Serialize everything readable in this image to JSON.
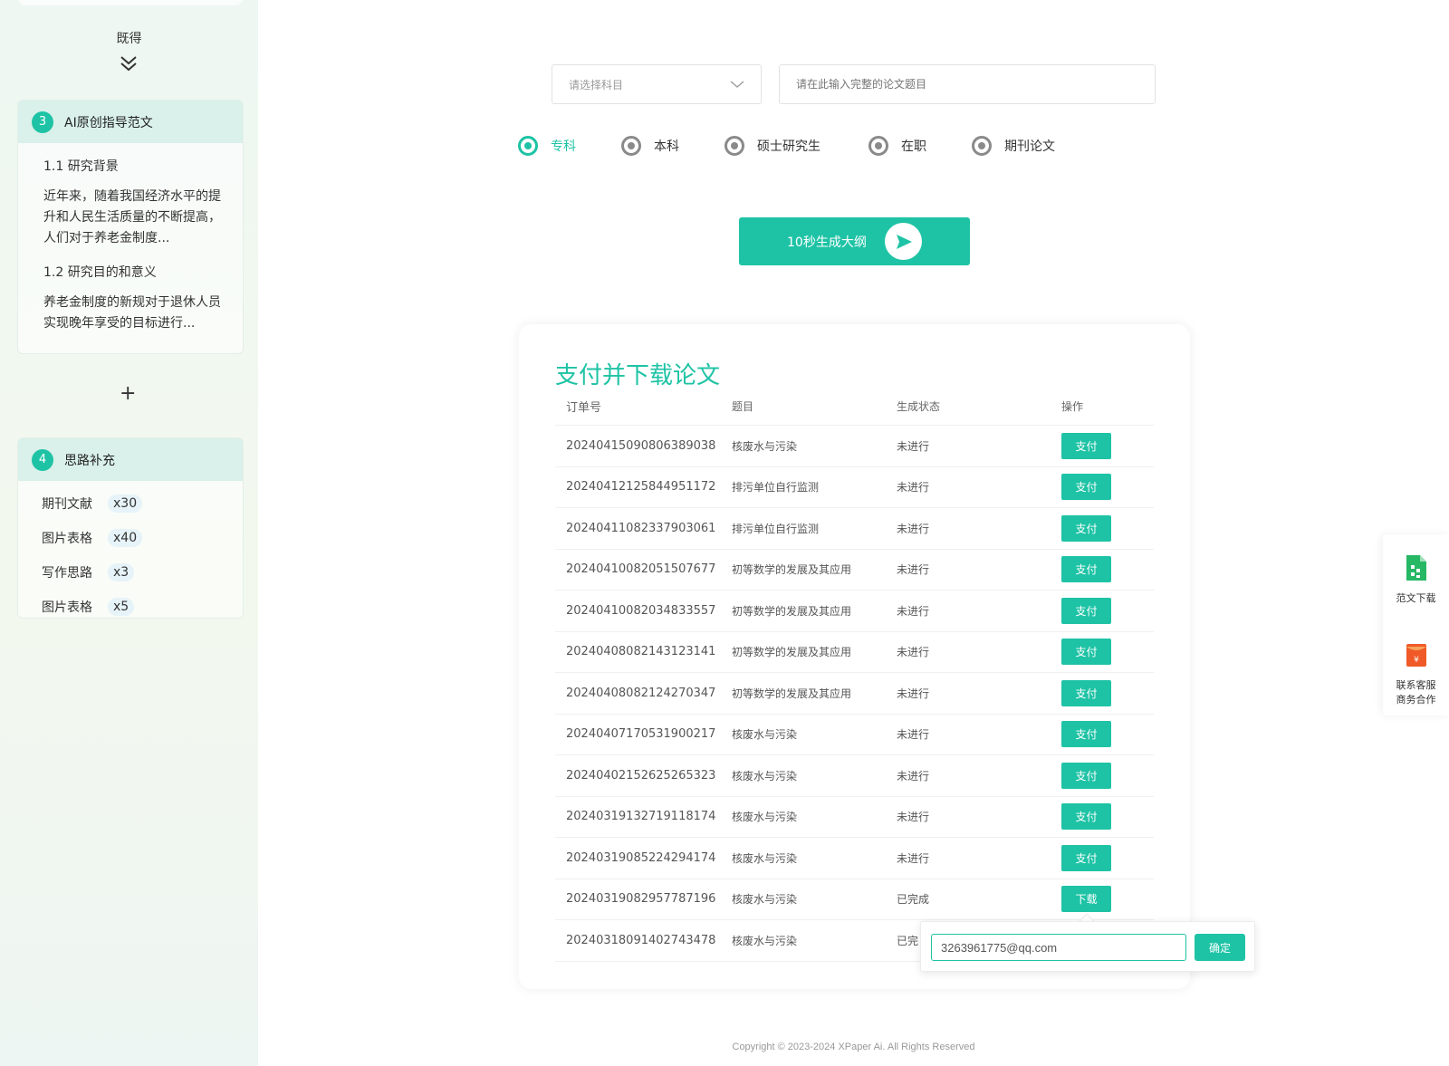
{
  "sidebar": {
    "jide_label": "既得",
    "card3": {
      "number": "3",
      "title": "AI原创指导范文",
      "sections": [
        {
          "title": "1.1 研究背景",
          "text": "近年来，随着我国经济水平的提升和人民生活质量的不断提高，人们对于养老金制度..."
        },
        {
          "title": "1.2 研究目的和意义",
          "text": "养老金制度的新规对于退休人员实现晚年享受的目标进行..."
        }
      ]
    },
    "plus_label": "+",
    "card4": {
      "number": "4",
      "title": "思路补充",
      "tags": [
        {
          "label": "期刊文献",
          "count": "x30"
        },
        {
          "label": "图片表格",
          "count": "x40"
        },
        {
          "label": "写作思路",
          "count": "x3"
        },
        {
          "label": "图片表格",
          "count": "x5"
        }
      ]
    }
  },
  "form": {
    "subject_placeholder": "请选择科目",
    "title_placeholder": "请在此输入完整的论文题目",
    "levels": [
      "专科",
      "本科",
      "硕士研究生",
      "在职",
      "期刊论文"
    ],
    "selected_level": "专科",
    "generate_label": "10秒生成大纲"
  },
  "pay": {
    "title": "支付并下载论文",
    "headers": [
      "订单号",
      "题目",
      "生成状态",
      "操作"
    ],
    "rows": [
      {
        "order": "20240415090806389038",
        "topic": "核废水与污染",
        "status": "未进行",
        "action": "支付"
      },
      {
        "order": "20240412125844951172",
        "topic": "排污单位自行监测",
        "status": "未进行",
        "action": "支付"
      },
      {
        "order": "20240411082337903061",
        "topic": "排污单位自行监测",
        "status": "未进行",
        "action": "支付"
      },
      {
        "order": "20240410082051507677",
        "topic": "初等数学的发展及其应用",
        "status": "未进行",
        "action": "支付"
      },
      {
        "order": "20240410082034833557",
        "topic": "初等数学的发展及其应用",
        "status": "未进行",
        "action": "支付"
      },
      {
        "order": "20240408082143123141",
        "topic": "初等数学的发展及其应用",
        "status": "未进行",
        "action": "支付"
      },
      {
        "order": "20240408082124270347",
        "topic": "初等数学的发展及其应用",
        "status": "未进行",
        "action": "支付"
      },
      {
        "order": "20240407170531900217",
        "topic": "核废水与污染",
        "status": "未进行",
        "action": "支付"
      },
      {
        "order": "20240402152625265323",
        "topic": "核废水与污染",
        "status": "未进行",
        "action": "支付"
      },
      {
        "order": "20240319132719118174",
        "topic": "核废水与污染",
        "status": "未进行",
        "action": "支付"
      },
      {
        "order": "20240319085224294174",
        "topic": "核废水与污染",
        "status": "未进行",
        "action": "支付"
      },
      {
        "order": "20240319082957787196",
        "topic": "核废水与污染",
        "status": "已完成",
        "action": "下载"
      },
      {
        "order": "20240318091402743478",
        "topic": "核废水与污染",
        "status": "已完",
        "action": ""
      }
    ]
  },
  "popover": {
    "email_value": "3263961775@qq.com",
    "confirm_label": "确定"
  },
  "float_bar": {
    "download_label": "范文下载",
    "contact_line1": "联系客服",
    "contact_line2": "商务合作"
  },
  "footer": {
    "copyright": "Copyright © 2023-2024 XPaper Ai. All Rights Reserved"
  },
  "colors": {
    "accent": "#1ec3a5",
    "sidebar_bg": "#eef7f2"
  }
}
